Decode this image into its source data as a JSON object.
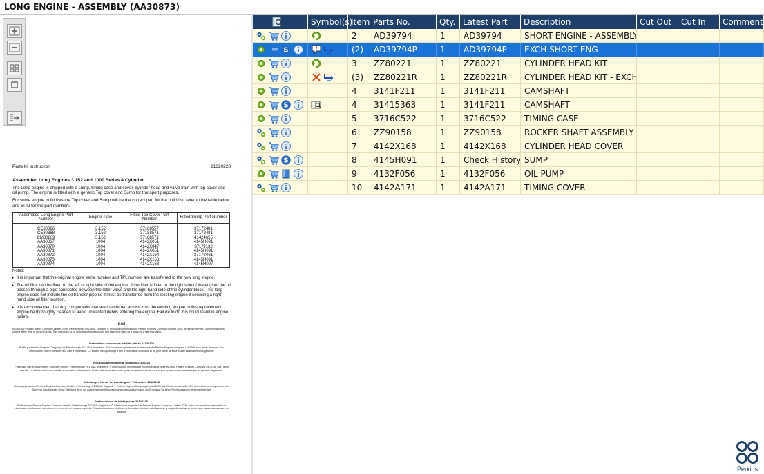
{
  "window": {
    "title": "LONG ENGINE - ASSEMBLY (AA30873)"
  },
  "toolbar": {
    "buttons": [
      {
        "name": "zoom-in",
        "icon": "plus-icon"
      },
      {
        "name": "zoom-out",
        "icon": "minus-icon"
      },
      {
        "name": "fit-page",
        "icon": "grid-icon"
      },
      {
        "name": "actual-size",
        "icon": "square-icon"
      },
      {
        "name": "export",
        "icon": "export-icon"
      }
    ]
  },
  "document": {
    "header_left": "Parts kit instruction",
    "header_right": "21820228",
    "title": "Assembled Long Engines 3.152 and 1000 Series 4 Cylinder",
    "para1": "The Long engine is shipped with a sump, timing case and cover, cylinder head and valve train with top cover and oil pump. The engine is fitted with a generic Top cover and Sump for transport purposes.",
    "para2": "For some engine build lists the Top cover and Sump will be the correct part for the build list, refer to the table below and SPI2 for the part numbers.",
    "table": {
      "headers": [
        "Assembled Long Engine Part Number",
        "Engine Type",
        "Fitted Top Cover Part Number",
        "Fitted Sump Part Number"
      ],
      "rows": [
        [
          "CE30866",
          "3.152",
          "37188557",
          "37172481"
        ],
        [
          "CE30868",
          "3.152",
          "37188571",
          "37172481"
        ],
        [
          "CM30869",
          "3.152",
          "37188571",
          "41424655"
        ],
        [
          "AA30867",
          "1004",
          "4142X051",
          "4145H091"
        ],
        [
          "AA30870",
          "1004",
          "4142X047",
          "3717J132"
        ],
        [
          "AA30871",
          "1004",
          "4142X051",
          "4145H091"
        ],
        [
          "AA30872",
          "1004",
          "4142X164",
          "3717Y061"
        ],
        [
          "AA30873",
          "1004",
          "4142X168",
          "4145H091"
        ],
        [
          "AA30874",
          "1004",
          "4142X168",
          "4145H097"
        ]
      ]
    },
    "notes_label": "Notes:",
    "notes": [
      "It is important that the original engine serial number and TPL number are transferred to the new long engine.",
      "The oil filter can be fitted to the left or right side of the engine. If the filter is fitted to the right side of the engine, the oil passes through a pipe connected between the relief valve and the right hand side of the cylinder block. This long engine does not include the oil transfer pipe so it must be transferred from the existing engine if servicing a right hand side oil filter location.",
      "It is recommended that any components that are transferred across from the existing engine to this replacement engine be thoroughly cleaned to avoid unwanted debris entering the engine. Failure to do this could result in engine failure."
    ],
    "end": "End",
    "fine_en": "Issued by Perkins Engines Company Limited 2006, Peterborough PE1 5NA, England. © Proprietary information of Perkins Engines Company Limited 2006, all rights reserved. The information is correct at the time of going to press. This instruction is for technical information only and cannot be used as a basis for a warranty claim.",
    "sections": [
      {
        "heading": "Instructions concernant le kit de pièces 21820228",
        "text": "Publié par Perkins Engines Company Ltd, Peterborough PE1 5NA, Angleterre. © Informations appartenant exclusivement à Perkins Engines Company Ltd 2006, tous droits réservés. Ces informations étaient correctes à la date d'impression. Ce bulletin n'est publié qu'à titre d'information technique et ne peut servir de base à une réclamation sous garantie."
      },
      {
        "heading": "Istruzioni per kit parti di ricambio 21820228",
        "text": "Pubblicato da Perkins Engines Company Limited, Peterborough PE1 5NA, Inghilterra. © Informazione commerciale in confidenza di proprietà della Perkins Engines Company Ltd 2006, tutti i diritti riservati. Le informazioni sono corrette al momento della stampa. Questa istruzione serve solo quale informazione tecnica e non può essere usata come base per un reclamo di garanzia."
      },
      {
        "heading": "Anleitungen für die Verwendung des Teilesatzes 21820228",
        "text": "Herausgegeben von Perkins Engines Company Limited, Peterborough PE1 5NA, England. © Perkins Engines Company Limited 2006, alle Rechte vorbehalten. Die Informationen entsprechen dem Stand bei Drucklegung. Diese Mitteilung dient nur zu technischen Informationszwecken und kann nicht als Grundlage für einen Rechtsanspruch verwendet werden."
      },
      {
        "heading": "Instrucciones de kit de piezas 21820228",
        "text": "Publicado por Perkins Engines Company Limited, Peterborough PE1 5NA, Inglaterra. © Información propiedad de Perkins Engines Company Limited 2006, todos los derechos reservados. La información publicada es correcta en el momento de pasar a imprenta. Estas instrucciones contienen información técnica exclusivamente y no pueden utilizarse como base para reclamaciones en garantía."
      }
    ]
  },
  "grid": {
    "columns": [
      "",
      "Symbol(s)",
      "Item",
      "Parts No.",
      "Qty.",
      "Latest Part No.",
      "Description",
      "Cut Out",
      "Cut In",
      "Comment"
    ],
    "header_icon": "search-document-icon",
    "rows": [
      {
        "icons": [
          "gears-icon",
          "cart-icon",
          "info-icon"
        ],
        "symbols": [
          "refresh-arrow-icon"
        ],
        "item": "2",
        "part_no": "AD39794",
        "qty": "1",
        "latest": "AD39794",
        "desc": "SHORT ENGINE - ASSEMBLY",
        "selected": false
      },
      {
        "icons": [
          "gear-icon",
          "cart-icon",
          "s-icon",
          "info-icon"
        ],
        "symbols": [
          "warning-bubble-icon",
          "branch-arrow-icon"
        ],
        "item": "(2)",
        "part_no": "AD39794P",
        "qty": "1",
        "latest": "AD39794P",
        "desc": "EXCH SHORT ENG",
        "selected": true
      },
      {
        "icons": [
          "gear-icon",
          "cart-icon",
          "info-icon"
        ],
        "symbols": [
          "refresh-arrow-icon"
        ],
        "item": "3",
        "part_no": "ZZ80221",
        "qty": "1",
        "latest": "ZZ80221",
        "desc": "CYLINDER HEAD KIT",
        "selected": false
      },
      {
        "icons": [
          "gear-icon",
          "cart-icon",
          "info-icon"
        ],
        "symbols": [
          "cross-icon",
          "branch-arrow-icon"
        ],
        "item": "(3)",
        "part_no": "ZZ80221R",
        "qty": "1",
        "latest": "ZZ80221R",
        "desc": "CYLINDER HEAD KIT - EXCH",
        "selected": false
      },
      {
        "icons": [
          "gear-icon",
          "cart-icon",
          "info-icon"
        ],
        "symbols": [],
        "item": "4",
        "part_no": "3141F211",
        "qty": "1",
        "latest": "3141F211",
        "desc": "CAMSHAFT",
        "selected": false
      },
      {
        "icons": [
          "gear-icon",
          "cart-icon",
          "s-icon",
          "info-icon"
        ],
        "symbols": [
          "book-search-icon"
        ],
        "item": "4",
        "part_no": "31415363",
        "qty": "1",
        "latest": "3141F211",
        "desc": "CAMSHAFT",
        "selected": false
      },
      {
        "icons": [
          "gear-icon",
          "cart-icon",
          "info-icon"
        ],
        "symbols": [],
        "item": "5",
        "part_no": "3716C522",
        "qty": "1",
        "latest": "3716C522",
        "desc": "TIMING CASE",
        "selected": false
      },
      {
        "icons": [
          "gears-icon",
          "cart-icon",
          "info-icon"
        ],
        "symbols": [],
        "item": "6",
        "part_no": "ZZ90158",
        "qty": "1",
        "latest": "ZZ90158",
        "desc": "ROCKER SHAFT ASSEMBLY",
        "selected": false
      },
      {
        "icons": [
          "gears-icon",
          "cart-icon",
          "info-icon"
        ],
        "symbols": [],
        "item": "7",
        "part_no": "4142X168",
        "qty": "1",
        "latest": "4142X168",
        "desc": "CYLINDER HEAD COVER",
        "selected": false
      },
      {
        "icons": [
          "gears-icon",
          "cart-icon",
          "s-icon",
          "info-icon"
        ],
        "symbols": [],
        "item": "8",
        "part_no": "4145H091",
        "qty": "1",
        "latest": "Check History",
        "desc": "SUMP",
        "selected": false
      },
      {
        "icons": [
          "gear-icon",
          "cart-icon",
          "book-icon",
          "info-icon"
        ],
        "symbols": [],
        "item": "9",
        "part_no": "4132F056",
        "qty": "1",
        "latest": "4132F056",
        "desc": "OIL PUMP",
        "selected": false
      },
      {
        "icons": [
          "gears-icon",
          "cart-icon",
          "info-icon"
        ],
        "symbols": [],
        "item": "10",
        "part_no": "4142A171",
        "qty": "1",
        "latest": "4142A171",
        "desc": "TIMING COVER",
        "selected": false
      }
    ]
  },
  "brand": {
    "name": "Perkins",
    "color": "#1d3f6a"
  },
  "colors": {
    "header_bg": "#1d3f6a",
    "row_bg": "#fffbe0",
    "selected_bg": "#1a73d6"
  }
}
